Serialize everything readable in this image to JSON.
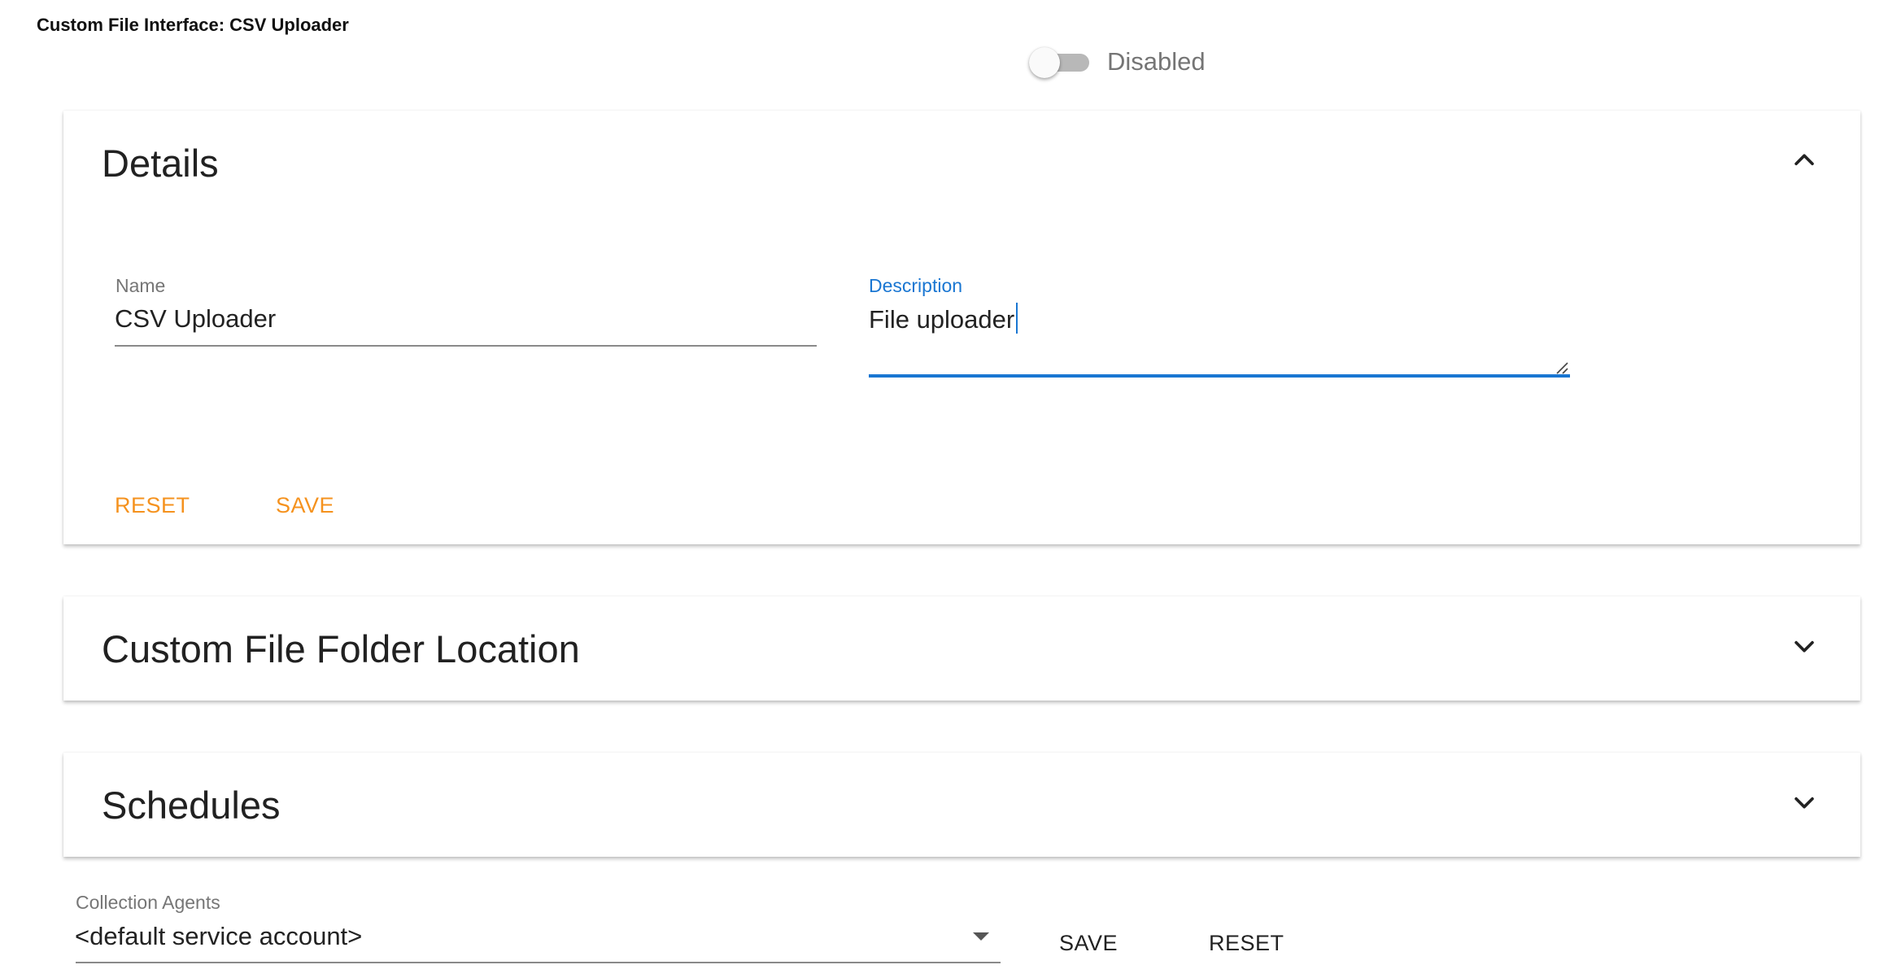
{
  "page": {
    "title": "Custom File Interface: CSV Uploader"
  },
  "status_toggle": {
    "label": "Disabled",
    "enabled": false
  },
  "details": {
    "title": "Details",
    "expanded": true,
    "name_field": {
      "label": "Name",
      "value": "CSV Uploader"
    },
    "description_field": {
      "label": "Description",
      "value": "File uploader"
    },
    "reset_label": "RESET",
    "save_label": "SAVE"
  },
  "folder_location": {
    "title": "Custom File Folder Location",
    "expanded": false
  },
  "schedules": {
    "title": "Schedules",
    "expanded": false
  },
  "collection_agents": {
    "label": "Collection Agents",
    "selected": "<default service account>",
    "save_label": "SAVE",
    "reset_label": "RESET"
  },
  "colors": {
    "accent_orange": "#f5921e",
    "focus_blue": "#1976d2",
    "toggle_off": "#b8b8b8"
  }
}
